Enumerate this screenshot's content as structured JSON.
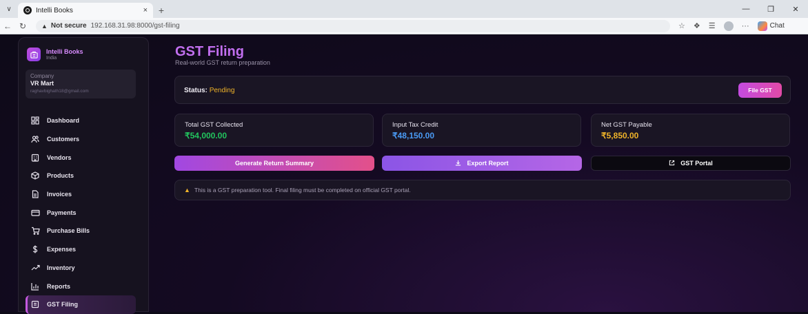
{
  "browser": {
    "tab_title": "Intelli Books",
    "tab_close": "×",
    "new_tab": "+",
    "url_secure_label": "Not secure",
    "url": "192.168.31.98:8000/gst-filing",
    "copilot_label": "Chat",
    "more": "···"
  },
  "sidebar": {
    "brand_name": "Intelli Books",
    "brand_sub": "India",
    "company_label": "Company",
    "company_name": "VR Mart",
    "company_email": "raghavbighath18@gmail.com",
    "items": [
      {
        "label": "Dashboard",
        "icon": "dashboard-icon"
      },
      {
        "label": "Customers",
        "icon": "users-icon"
      },
      {
        "label": "Vendors",
        "icon": "building-icon"
      },
      {
        "label": "Products",
        "icon": "box-icon"
      },
      {
        "label": "Invoices",
        "icon": "file-icon"
      },
      {
        "label": "Payments",
        "icon": "card-icon"
      },
      {
        "label": "Purchase Bills",
        "icon": "cart-icon"
      },
      {
        "label": "Expenses",
        "icon": "dollar-icon"
      },
      {
        "label": "Inventory",
        "icon": "trend-icon"
      },
      {
        "label": "Reports",
        "icon": "bar-chart-icon"
      },
      {
        "label": "GST Filing",
        "icon": "receipt-icon",
        "active": true
      }
    ]
  },
  "main": {
    "title": "GST Filing",
    "subtitle": "Real-world GST return preparation",
    "status_label": "Status:",
    "status_value": "Pending",
    "file_button": "File GST",
    "stats": [
      {
        "label": "Total GST Collected",
        "value": "₹54,000.00",
        "color": "#22c55e"
      },
      {
        "label": "Input Tax Credit",
        "value": "₹48,150.00",
        "color": "#4a9bf5"
      },
      {
        "label": "Net GST Payable",
        "value": "₹5,850.00",
        "color": "#f0b429"
      }
    ],
    "actions": {
      "generate": "Generate Return Summary",
      "export": "Export Report",
      "portal": "GST Portal"
    },
    "note": "This is a GST preparation tool. Final filing must be completed on official GST portal."
  },
  "colors": {
    "accent": "#c26ff0",
    "status_pending": "#f0b429"
  }
}
